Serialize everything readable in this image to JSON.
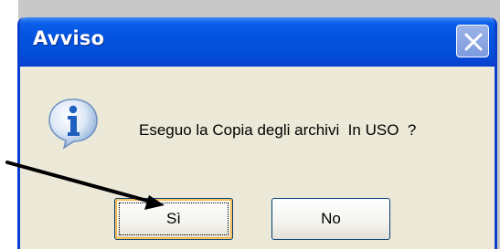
{
  "dialog": {
    "title": "Avviso",
    "message": "Eseguo la Copia degli archivi  In USO  ?",
    "icon": "information-icon",
    "buttons": {
      "yes_label": "Sì",
      "no_label": "No"
    }
  },
  "colors": {
    "titlebar": "#0453e0",
    "dialog_face": "#ece9d8",
    "border": "#0a3fd0",
    "focus_highlight": "#f5b53f"
  }
}
